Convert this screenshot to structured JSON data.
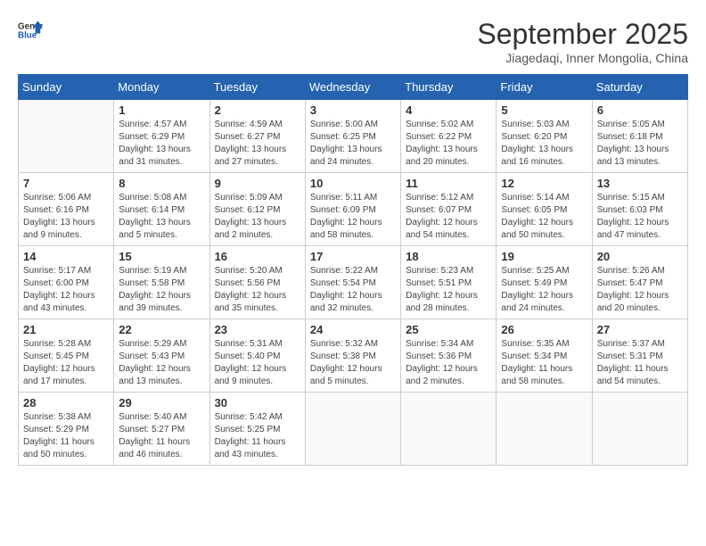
{
  "logo": {
    "line1": "General",
    "line2": "Blue"
  },
  "title": "September 2025",
  "subtitle": "Jiagedaqi, Inner Mongolia, China",
  "weekdays": [
    "Sunday",
    "Monday",
    "Tuesday",
    "Wednesday",
    "Thursday",
    "Friday",
    "Saturday"
  ],
  "weeks": [
    [
      {
        "day": "",
        "sunrise": "",
        "sunset": "",
        "daylight": ""
      },
      {
        "day": "1",
        "sunrise": "Sunrise: 4:57 AM",
        "sunset": "Sunset: 6:29 PM",
        "daylight": "Daylight: 13 hours and 31 minutes."
      },
      {
        "day": "2",
        "sunrise": "Sunrise: 4:59 AM",
        "sunset": "Sunset: 6:27 PM",
        "daylight": "Daylight: 13 hours and 27 minutes."
      },
      {
        "day": "3",
        "sunrise": "Sunrise: 5:00 AM",
        "sunset": "Sunset: 6:25 PM",
        "daylight": "Daylight: 13 hours and 24 minutes."
      },
      {
        "day": "4",
        "sunrise": "Sunrise: 5:02 AM",
        "sunset": "Sunset: 6:22 PM",
        "daylight": "Daylight: 13 hours and 20 minutes."
      },
      {
        "day": "5",
        "sunrise": "Sunrise: 5:03 AM",
        "sunset": "Sunset: 6:20 PM",
        "daylight": "Daylight: 13 hours and 16 minutes."
      },
      {
        "day": "6",
        "sunrise": "Sunrise: 5:05 AM",
        "sunset": "Sunset: 6:18 PM",
        "daylight": "Daylight: 13 hours and 13 minutes."
      }
    ],
    [
      {
        "day": "7",
        "sunrise": "Sunrise: 5:06 AM",
        "sunset": "Sunset: 6:16 PM",
        "daylight": "Daylight: 13 hours and 9 minutes."
      },
      {
        "day": "8",
        "sunrise": "Sunrise: 5:08 AM",
        "sunset": "Sunset: 6:14 PM",
        "daylight": "Daylight: 13 hours and 5 minutes."
      },
      {
        "day": "9",
        "sunrise": "Sunrise: 5:09 AM",
        "sunset": "Sunset: 6:12 PM",
        "daylight": "Daylight: 13 hours and 2 minutes."
      },
      {
        "day": "10",
        "sunrise": "Sunrise: 5:11 AM",
        "sunset": "Sunset: 6:09 PM",
        "daylight": "Daylight: 12 hours and 58 minutes."
      },
      {
        "day": "11",
        "sunrise": "Sunrise: 5:12 AM",
        "sunset": "Sunset: 6:07 PM",
        "daylight": "Daylight: 12 hours and 54 minutes."
      },
      {
        "day": "12",
        "sunrise": "Sunrise: 5:14 AM",
        "sunset": "Sunset: 6:05 PM",
        "daylight": "Daylight: 12 hours and 50 minutes."
      },
      {
        "day": "13",
        "sunrise": "Sunrise: 5:15 AM",
        "sunset": "Sunset: 6:03 PM",
        "daylight": "Daylight: 12 hours and 47 minutes."
      }
    ],
    [
      {
        "day": "14",
        "sunrise": "Sunrise: 5:17 AM",
        "sunset": "Sunset: 6:00 PM",
        "daylight": "Daylight: 12 hours and 43 minutes."
      },
      {
        "day": "15",
        "sunrise": "Sunrise: 5:19 AM",
        "sunset": "Sunset: 5:58 PM",
        "daylight": "Daylight: 12 hours and 39 minutes."
      },
      {
        "day": "16",
        "sunrise": "Sunrise: 5:20 AM",
        "sunset": "Sunset: 5:56 PM",
        "daylight": "Daylight: 12 hours and 35 minutes."
      },
      {
        "day": "17",
        "sunrise": "Sunrise: 5:22 AM",
        "sunset": "Sunset: 5:54 PM",
        "daylight": "Daylight: 12 hours and 32 minutes."
      },
      {
        "day": "18",
        "sunrise": "Sunrise: 5:23 AM",
        "sunset": "Sunset: 5:51 PM",
        "daylight": "Daylight: 12 hours and 28 minutes."
      },
      {
        "day": "19",
        "sunrise": "Sunrise: 5:25 AM",
        "sunset": "Sunset: 5:49 PM",
        "daylight": "Daylight: 12 hours and 24 minutes."
      },
      {
        "day": "20",
        "sunrise": "Sunrise: 5:26 AM",
        "sunset": "Sunset: 5:47 PM",
        "daylight": "Daylight: 12 hours and 20 minutes."
      }
    ],
    [
      {
        "day": "21",
        "sunrise": "Sunrise: 5:28 AM",
        "sunset": "Sunset: 5:45 PM",
        "daylight": "Daylight: 12 hours and 17 minutes."
      },
      {
        "day": "22",
        "sunrise": "Sunrise: 5:29 AM",
        "sunset": "Sunset: 5:43 PM",
        "daylight": "Daylight: 12 hours and 13 minutes."
      },
      {
        "day": "23",
        "sunrise": "Sunrise: 5:31 AM",
        "sunset": "Sunset: 5:40 PM",
        "daylight": "Daylight: 12 hours and 9 minutes."
      },
      {
        "day": "24",
        "sunrise": "Sunrise: 5:32 AM",
        "sunset": "Sunset: 5:38 PM",
        "daylight": "Daylight: 12 hours and 5 minutes."
      },
      {
        "day": "25",
        "sunrise": "Sunrise: 5:34 AM",
        "sunset": "Sunset: 5:36 PM",
        "daylight": "Daylight: 12 hours and 2 minutes."
      },
      {
        "day": "26",
        "sunrise": "Sunrise: 5:35 AM",
        "sunset": "Sunset: 5:34 PM",
        "daylight": "Daylight: 11 hours and 58 minutes."
      },
      {
        "day": "27",
        "sunrise": "Sunrise: 5:37 AM",
        "sunset": "Sunset: 5:31 PM",
        "daylight": "Daylight: 11 hours and 54 minutes."
      }
    ],
    [
      {
        "day": "28",
        "sunrise": "Sunrise: 5:38 AM",
        "sunset": "Sunset: 5:29 PM",
        "daylight": "Daylight: 11 hours and 50 minutes."
      },
      {
        "day": "29",
        "sunrise": "Sunrise: 5:40 AM",
        "sunset": "Sunset: 5:27 PM",
        "daylight": "Daylight: 11 hours and 46 minutes."
      },
      {
        "day": "30",
        "sunrise": "Sunrise: 5:42 AM",
        "sunset": "Sunset: 5:25 PM",
        "daylight": "Daylight: 11 hours and 43 minutes."
      },
      {
        "day": "",
        "sunrise": "",
        "sunset": "",
        "daylight": ""
      },
      {
        "day": "",
        "sunrise": "",
        "sunset": "",
        "daylight": ""
      },
      {
        "day": "",
        "sunrise": "",
        "sunset": "",
        "daylight": ""
      },
      {
        "day": "",
        "sunrise": "",
        "sunset": "",
        "daylight": ""
      }
    ]
  ]
}
